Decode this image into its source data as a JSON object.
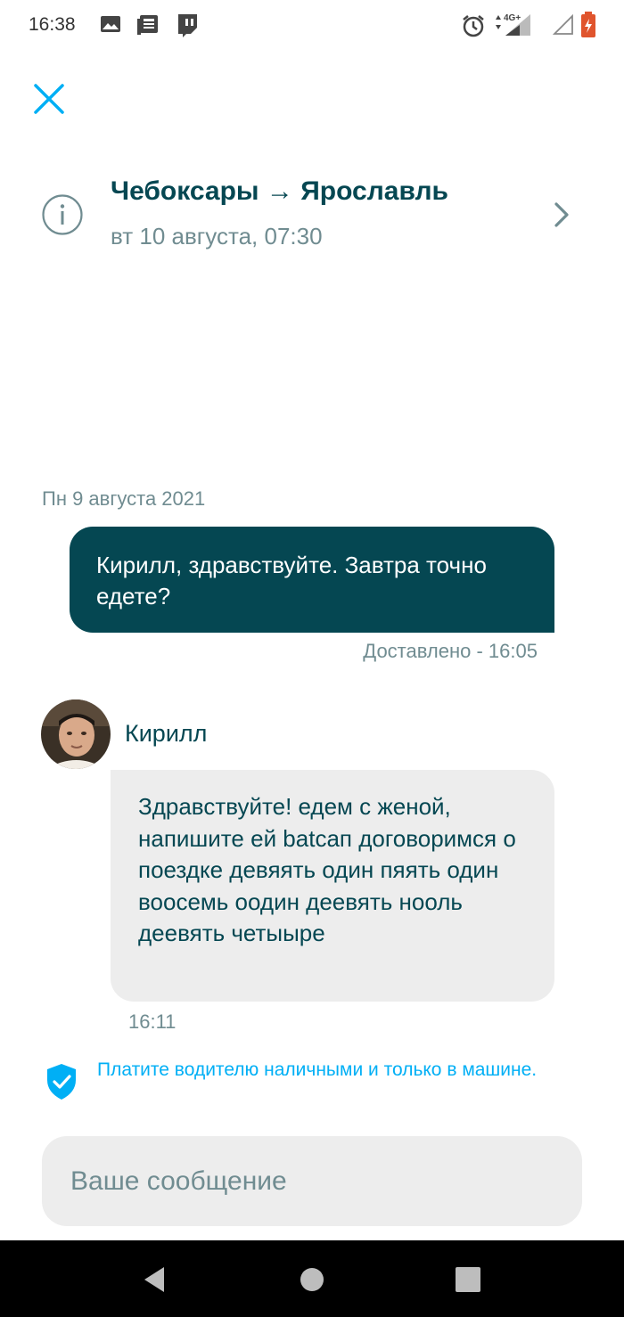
{
  "status_bar": {
    "time": "16:38",
    "left_icons": [
      "image-icon",
      "news-icon",
      "twitch-icon"
    ],
    "right_icons": [
      "alarm-icon",
      "signal-4g-icon",
      "signal-icon",
      "battery-icon"
    ],
    "network_label": "4G+"
  },
  "header": {
    "close_icon": "close-icon",
    "trip_route": "Чебоксары → Ярославль",
    "trip_datetime": "вт 10 августа, 07:30",
    "info_icon": "info-icon",
    "chevron_icon": "chevron-right-icon"
  },
  "chat": {
    "day_label": "Пн 9 августа 2021",
    "outgoing": {
      "text": "Кирилл, здравствуйте. Завтра точно едете?",
      "status": "Доставлено - 16:05"
    },
    "incoming": {
      "sender": "Кирилл",
      "text": "Здравствуйте! едем с женой, напишите ей batcап договоримся о поездке девяять один пяять один воосемь оодин деевять нооль деевять четыыре",
      "time": "16:11"
    }
  },
  "safety_notice": {
    "text": "Платите водителю наличными и только в машине.",
    "icon": "shield-check-icon"
  },
  "composer": {
    "placeholder": "Ваше сообщение",
    "value": ""
  },
  "nav_bar": {
    "buttons": [
      "back-icon",
      "home-icon",
      "recents-icon"
    ]
  },
  "colors": {
    "primary": "#054752",
    "secondary_text": "#708c91",
    "accent": "#00aff5",
    "bubble_incoming": "#ededed"
  }
}
